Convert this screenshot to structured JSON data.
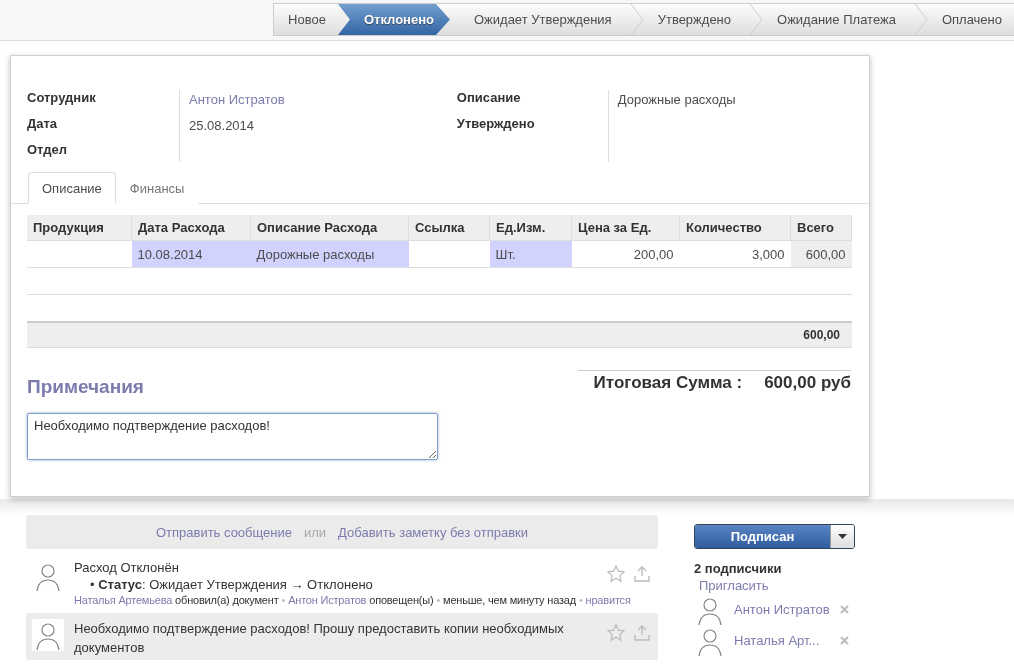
{
  "stages": [
    {
      "label": "Новое",
      "selected": false
    },
    {
      "label": "Отклонено",
      "selected": true
    },
    {
      "label": "Ожидает Утверждения",
      "selected": false
    },
    {
      "label": "Утверждено",
      "selected": false
    },
    {
      "label": "Ожидание Платежа",
      "selected": false
    },
    {
      "label": "Оплачено",
      "selected": false
    }
  ],
  "form": {
    "left": {
      "labels": [
        "Сотрудник",
        "Дата",
        "Отдел"
      ],
      "values": [
        {
          "text": "Антон Истратов",
          "kind": "link"
        },
        {
          "text": "25.08.2014",
          "kind": "text"
        }
      ]
    },
    "right": {
      "labels": [
        "Описание",
        "Утверждено"
      ],
      "values": [
        {
          "text": "Дорожные расходы",
          "kind": "text"
        }
      ]
    },
    "tabs": [
      {
        "label": "Описание",
        "selected": true
      },
      {
        "label": "Финансы",
        "selected": false
      }
    ],
    "table": {
      "columns": [
        "Продукция",
        "Дата Расхода",
        "Описание Расхода",
        "Ссылка",
        "Ед.Изм.",
        "Цена за Ед.",
        "Количество",
        "Всего"
      ],
      "rows": [
        {
          "cells": [
            {
              "text": "",
              "kind": "plain"
            },
            {
              "text": "10.08.2014",
              "kind": "required"
            },
            {
              "text": "Дорожные расходы",
              "kind": "required"
            },
            {
              "text": "",
              "kind": "plain"
            },
            {
              "text": "Шт.",
              "kind": "required"
            },
            {
              "text": "200,00",
              "kind": "plain"
            },
            {
              "text": "3,000",
              "kind": "plain"
            },
            {
              "text": "600,00",
              "kind": "readonly"
            }
          ]
        }
      ],
      "footer_total": "600,00"
    },
    "notes": {
      "title": "Примечания",
      "value": "Необходимо подтверждение расходов!"
    },
    "total": {
      "label": "Итоговая Сумма :",
      "value": "600,00 руб"
    }
  },
  "chatter": {
    "composer": {
      "send": "Отправить сообщение",
      "or": "или",
      "note": "Добавить заметку без отправки"
    },
    "messages": [
      {
        "kind": "tracking",
        "title": "Расход Отклонён",
        "change": "• **Статус**: Ожидает Утверждения → Отклонено",
        "meta": [
          {
            "text": "Наталья Артемьева",
            "kind": "link"
          },
          {
            "text": "обновил(а) документ",
            "kind": "text"
          },
          {
            "text": "•",
            "kind": "sep"
          },
          {
            "text": "Антон Истратов",
            "kind": "link"
          },
          {
            "text": "оповещен(ы)",
            "kind": "text"
          },
          {
            "text": "•",
            "kind": "sep"
          },
          {
            "text": "меньше, чем минуту назад",
            "kind": "text"
          },
          {
            "text": "•",
            "kind": "sep"
          },
          {
            "text": "нравится",
            "kind": "link"
          }
        ]
      },
      {
        "kind": "comment",
        "body": "Необходимо подтверждение расходов! Прошу предоставить копии необходимых документов"
      }
    ]
  },
  "followers": {
    "button": "Подписан",
    "count": "2 подписчики",
    "invite": "Пригласить",
    "list": [
      {
        "name": "Антон Истратов"
      },
      {
        "name": "Наталья Арт..."
      }
    ]
  }
}
